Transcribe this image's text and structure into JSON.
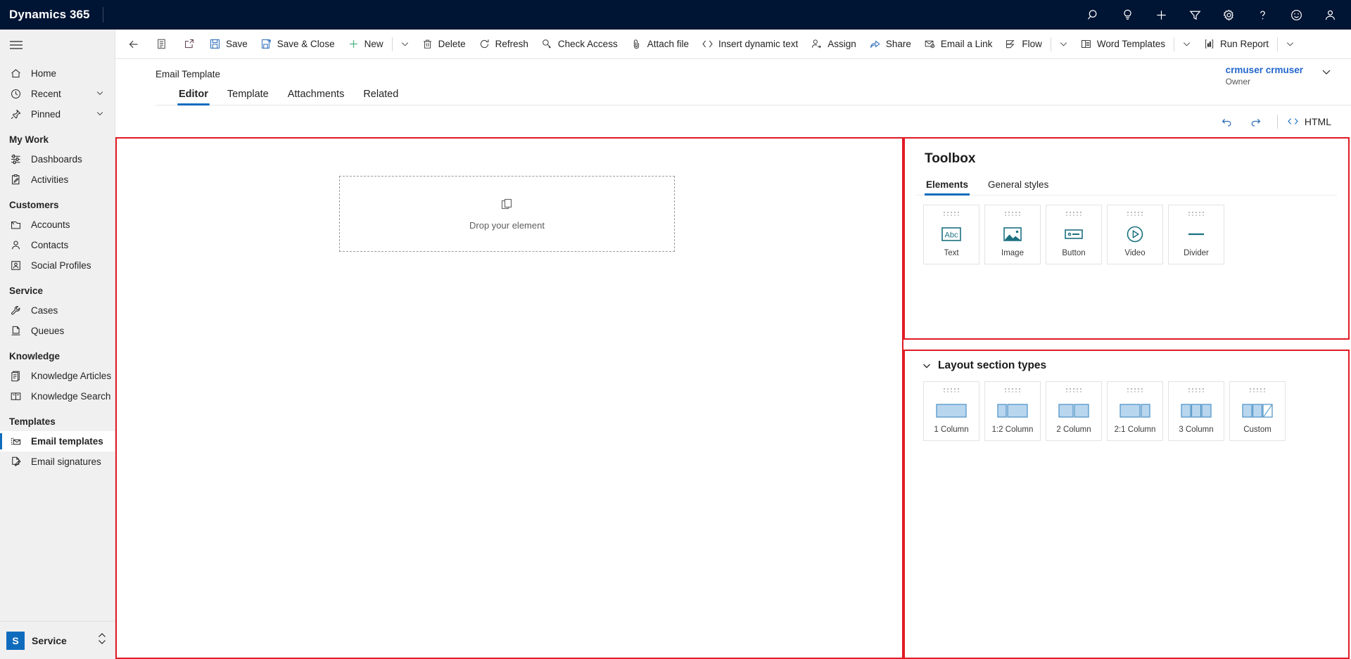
{
  "header": {
    "brand": "Dynamics 365",
    "icons": [
      {
        "name": "search-icon",
        "label": "Search"
      },
      {
        "name": "lightbulb-icon",
        "label": "Assistant"
      },
      {
        "name": "plus-icon",
        "label": "Quick create"
      },
      {
        "name": "filter-icon",
        "label": "Filter"
      },
      {
        "name": "gear-icon",
        "label": "Settings"
      },
      {
        "name": "help-icon",
        "label": "Help"
      },
      {
        "name": "smiley-icon",
        "label": "Feedback"
      },
      {
        "name": "person-icon",
        "label": "Account manager"
      }
    ]
  },
  "sidebar": {
    "items": [
      {
        "label": "Home",
        "icon": "home-icon",
        "type": "item",
        "chevron": false,
        "selected": false
      },
      {
        "label": "Recent",
        "icon": "clock-icon",
        "type": "item",
        "chevron": true,
        "selected": false
      },
      {
        "label": "Pinned",
        "icon": "pin-icon",
        "type": "item",
        "chevron": true,
        "selected": false
      },
      {
        "label": "My Work",
        "type": "group"
      },
      {
        "label": "Dashboards",
        "icon": "dashboard-icon",
        "type": "item",
        "chevron": false,
        "selected": false
      },
      {
        "label": "Activities",
        "icon": "activities-icon",
        "type": "item",
        "chevron": false,
        "selected": false
      },
      {
        "label": "Customers",
        "type": "group"
      },
      {
        "label": "Accounts",
        "icon": "accounts-icon",
        "type": "item",
        "chevron": false,
        "selected": false
      },
      {
        "label": "Contacts",
        "icon": "contacts-icon",
        "type": "item",
        "chevron": false,
        "selected": false
      },
      {
        "label": "Social Profiles",
        "icon": "social-profile-icon",
        "type": "item",
        "chevron": false,
        "selected": false
      },
      {
        "label": "Service",
        "type": "group"
      },
      {
        "label": "Cases",
        "icon": "wrench-icon",
        "type": "item",
        "chevron": false,
        "selected": false
      },
      {
        "label": "Queues",
        "icon": "queues-icon",
        "type": "item",
        "chevron": false,
        "selected": false
      },
      {
        "label": "Knowledge",
        "type": "group"
      },
      {
        "label": "Knowledge Articles",
        "icon": "knowledge-article-icon",
        "type": "item",
        "chevron": false,
        "selected": false
      },
      {
        "label": "Knowledge Search",
        "icon": "book-icon",
        "type": "item",
        "chevron": false,
        "selected": false
      },
      {
        "label": "Templates",
        "type": "group"
      },
      {
        "label": "Email templates",
        "icon": "email-template-icon",
        "type": "item",
        "chevron": false,
        "selected": true
      },
      {
        "label": "Email signatures",
        "icon": "email-signature-icon",
        "type": "item",
        "chevron": false,
        "selected": false
      }
    ],
    "app_switcher": {
      "initial": "S",
      "name": "Service"
    }
  },
  "commandbar": {
    "items": [
      {
        "label": "",
        "icon": "back-arrow-icon",
        "kind": "iconly"
      },
      {
        "label": "",
        "icon": "form-icon",
        "kind": "iconly"
      },
      {
        "label": "",
        "icon": "popout-icon",
        "kind": "iconly"
      },
      {
        "label": "Save",
        "icon": "save-icon",
        "kind": "text"
      },
      {
        "label": "Save & Close",
        "icon": "save-close-icon",
        "kind": "text"
      },
      {
        "label": "New",
        "icon": "plus-icon",
        "kind": "text"
      },
      {
        "label": "",
        "icon": "chevron-down-icon",
        "kind": "caret"
      },
      {
        "label": "Delete",
        "icon": "trash-icon",
        "kind": "text"
      },
      {
        "label": "Refresh",
        "icon": "refresh-icon",
        "kind": "text"
      },
      {
        "label": "Check Access",
        "icon": "check-access-icon",
        "kind": "text"
      },
      {
        "label": "Attach file",
        "icon": "paperclip-icon",
        "kind": "text"
      },
      {
        "label": "Insert dynamic text",
        "icon": "code-icon",
        "kind": "text"
      },
      {
        "label": "Assign",
        "icon": "assign-icon",
        "kind": "text"
      },
      {
        "label": "Share",
        "icon": "share-icon",
        "kind": "text"
      },
      {
        "label": "Email a Link",
        "icon": "email-link-icon",
        "kind": "text"
      },
      {
        "label": "Flow",
        "icon": "flow-icon",
        "kind": "text"
      },
      {
        "label": "",
        "icon": "chevron-down-icon",
        "kind": "caret"
      },
      {
        "label": "Word Templates",
        "icon": "word-template-icon",
        "kind": "text"
      },
      {
        "label": "",
        "icon": "chevron-down-icon",
        "kind": "caret"
      },
      {
        "label": "Run Report",
        "icon": "run-report-icon",
        "kind": "text"
      },
      {
        "label": "",
        "icon": "chevron-down-icon",
        "kind": "caret"
      }
    ]
  },
  "record": {
    "title": "Email Template",
    "owner_name": "crmuser crmuser",
    "owner_label": "Owner",
    "tabs": [
      {
        "label": "Editor",
        "active": true
      },
      {
        "label": "Template",
        "active": false
      },
      {
        "label": "Attachments",
        "active": false
      },
      {
        "label": "Related",
        "active": false
      }
    ]
  },
  "canvas": {
    "dropzone_text": "Drop your element",
    "dropzone_icon": "copy-element-icon"
  },
  "editor_toolbar": {
    "undo_icon": "undo-icon",
    "redo_icon": "redo-icon",
    "html_label": "HTML",
    "html_icon": "code-icon"
  },
  "toolbox": {
    "title": "Toolbox",
    "tabs": [
      {
        "label": "Elements",
        "active": true
      },
      {
        "label": "General styles",
        "active": false
      }
    ],
    "elements": [
      {
        "label": "Text",
        "icon": "text-abc-icon"
      },
      {
        "label": "Image",
        "icon": "image-icon"
      },
      {
        "label": "Button",
        "icon": "button-icon"
      },
      {
        "label": "Video",
        "icon": "video-play-icon"
      },
      {
        "label": "Divider",
        "icon": "divider-icon"
      }
    ]
  },
  "layout_sections": {
    "title": "Layout section types",
    "chevron_icon": "chevron-down-icon",
    "items": [
      {
        "label": "1 Column",
        "icon": "layout-1col-icon"
      },
      {
        "label": "1:2 Column",
        "icon": "layout-1-2col-icon"
      },
      {
        "label": "2 Column",
        "icon": "layout-2col-icon"
      },
      {
        "label": "2:1 Column",
        "icon": "layout-2-1col-icon"
      },
      {
        "label": "3 Column",
        "icon": "layout-3col-icon"
      },
      {
        "label": "Custom",
        "icon": "layout-custom-icon"
      }
    ]
  },
  "colors": {
    "header_bg": "#001433",
    "accent": "#0f6cbd",
    "highlight_border": "#e01b24",
    "element_icon": "#1a7080"
  }
}
